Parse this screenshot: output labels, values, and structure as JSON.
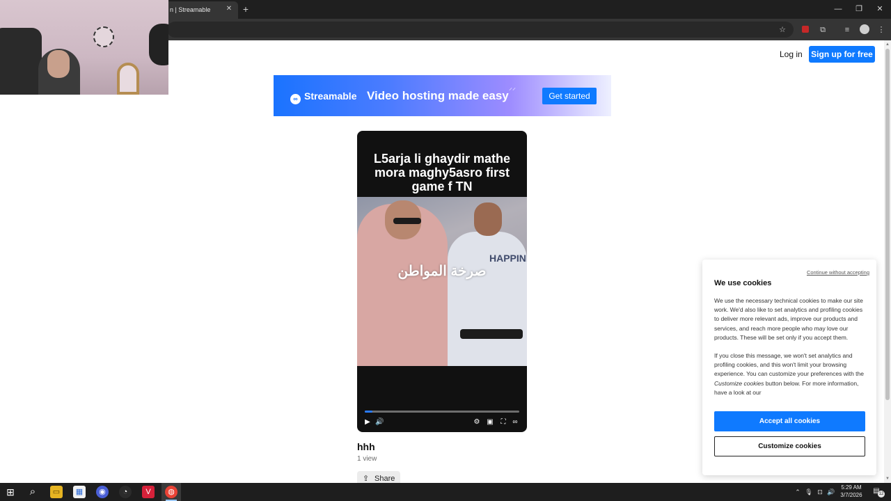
{
  "browser": {
    "tab_title": "n | Streamable",
    "tab_close": "✕",
    "new_tab": "+",
    "window_controls": {
      "minimize": "—",
      "restore": "❐",
      "close": "✕"
    },
    "toolbar_icons": {
      "bookmark": "☆",
      "extensions": "⧉",
      "media": "≡",
      "menu": "⋮"
    }
  },
  "header": {
    "login_label": "Log in",
    "signup_label": "Sign up for free"
  },
  "banner": {
    "logo_icon": "∞",
    "logo_text": "Streamable",
    "tagline": "Video hosting made easy",
    "spark": "⸝⸝",
    "cta_label": "Get started"
  },
  "video": {
    "caption_line1": "L5arja li ghaydir mathe",
    "caption_line2": "mora maghy5asro first",
    "caption_line3": "game f TN",
    "overlay_text": "صرخة المواطن",
    "shirt_text": "HAPPINES",
    "progress": 0.05,
    "controls": {
      "play": "▶",
      "volume": "🔊",
      "settings": "⚙",
      "pip": "▣",
      "fullscreen": "⛶",
      "logo": "∞"
    },
    "title": "hhh",
    "views": "1 view",
    "share_icon": "⇪",
    "share_label": "Share"
  },
  "cookie": {
    "continue_link": "Continue without accepting",
    "title": "We use cookies",
    "paragraph1": "We use the necessary technical cookies to make our site work. We'd also like to set analytics and profiling cookies to deliver more relevant ads, improve our products and services, and reach more people who may love our products. These will be set only if you accept them.",
    "paragraph2_before": "If you close this message, we won't set analytics and profiling cookies, and this won't limit your browsing experience. You can customize your preferences with the ",
    "paragraph2_em": "Customize cookies",
    "paragraph2_after": " button below. For more information, have a look at our",
    "accept_label": "Accept all cookies",
    "customize_label": "Customize cookies"
  },
  "taskbar": {
    "start_icon": "⊞",
    "search_icon": "⌕",
    "apps": [
      "▭",
      "▦",
      "◉",
      "◔",
      "V",
      "◍"
    ],
    "tray_icons": {
      "chevron": "⌃",
      "mic": "🎙",
      "network": "⊡",
      "volume": "🔊"
    },
    "time": "5:29 AM",
    "date": "3/7/2026",
    "notif_icon": "▤",
    "notif_count": "12"
  }
}
